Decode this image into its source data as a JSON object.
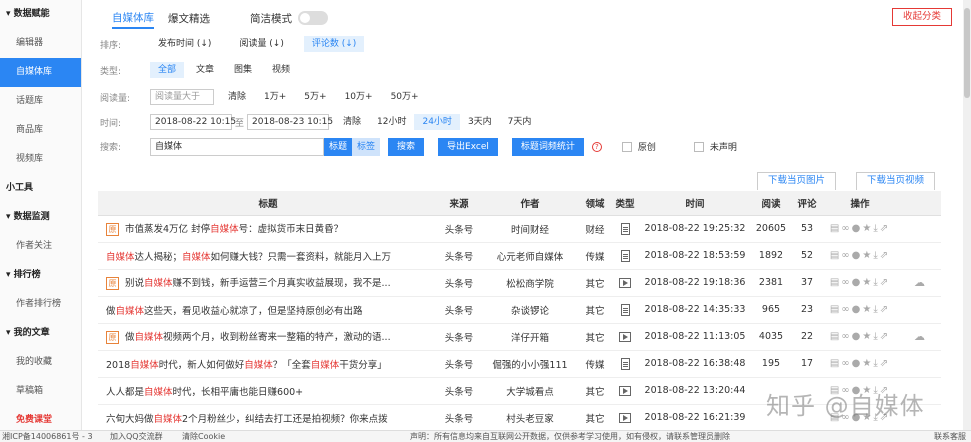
{
  "sidebar": {
    "items": [
      {
        "label": "▾ 数据赋能",
        "kind": "section"
      },
      {
        "label": "编辑器",
        "kind": "item"
      },
      {
        "label": "自媒体库",
        "kind": "active"
      },
      {
        "label": "话题库",
        "kind": "item"
      },
      {
        "label": "商品库",
        "kind": "item"
      },
      {
        "label": "视频库",
        "kind": "item"
      },
      {
        "label": "小工具",
        "kind": "section"
      },
      {
        "label": "▾ 数据监测",
        "kind": "section"
      },
      {
        "label": "作者关注",
        "kind": "item"
      },
      {
        "label": "▾ 排行榜",
        "kind": "section"
      },
      {
        "label": "作者排行榜",
        "kind": "item"
      },
      {
        "label": "▾ 我的文章",
        "kind": "section"
      },
      {
        "label": "我的收藏",
        "kind": "item"
      },
      {
        "label": "草稿箱",
        "kind": "item"
      },
      {
        "label": "免费课堂",
        "kind": "red"
      }
    ]
  },
  "tabs": {
    "tab1": "自媒体库",
    "tab2": "爆文精选",
    "simple_mode": "简洁模式"
  },
  "collapse_button": "收起分类",
  "filters": {
    "sort": {
      "label": "排序:",
      "options": [
        "发布时间 (↓)",
        "阅读量 (↓)",
        "评论数 (↓)"
      ],
      "selected": 2
    },
    "type": {
      "label": "类型:",
      "options": [
        "全部",
        "文章",
        "图集",
        "视频"
      ],
      "selected": 0
    },
    "reads": {
      "label": "阅读量:",
      "placeholder": "阅读量大于",
      "options": [
        "清除",
        "1万+",
        "5万+",
        "10万+",
        "50万+"
      ]
    },
    "time": {
      "label": "时间:",
      "start": "2018-08-22 10:15",
      "sep": "至",
      "end": "2018-08-23 10:15",
      "options": [
        "清除",
        "12小时",
        "24小时",
        "3天内",
        "7天内"
      ],
      "selected": 2
    },
    "search": {
      "label": "搜索:",
      "value": "自媒体",
      "mode1": "标题",
      "mode2": "标签",
      "btn_search": "搜索",
      "btn_export": "导出Excel",
      "btn_stats": "标题词频统计",
      "help": "?",
      "chk_original": "原创",
      "chk_undeclared": "未声明"
    }
  },
  "download": {
    "images": "下载当页图片",
    "videos": "下载当页视频"
  },
  "table": {
    "headers": [
      "标题",
      "来源",
      "作者",
      "领域",
      "类型",
      "时间",
      "阅读",
      "评论",
      "操作"
    ],
    "rows": [
      {
        "badge": "原",
        "p1": "市值蒸发4万亿 封停",
        "hl": "自媒体",
        "p2": "号：虚拟货币末日黄昏？",
        "source": "头条号",
        "author": "时间财经",
        "field": "财经",
        "type": "doc",
        "time": "2018-08-22 19:25:32",
        "reads": "20605",
        "comments": "53",
        "cloud": ""
      },
      {
        "badge": "",
        "p1": "",
        "hl": "自媒体",
        "p2": "达人揭秘；",
        "hl2": "自媒体",
        "p3": "如何赚大钱？只需一套资料，就能月入上万",
        "source": "头条号",
        "author": "心元老师自媒体",
        "field": "传媒",
        "type": "doc",
        "time": "2018-08-22 18:53:59",
        "reads": "1892",
        "comments": "52",
        "cloud": ""
      },
      {
        "badge": "原",
        "p1": "别说",
        "hl": "自媒体",
        "p2": "赚不到钱，新手运营三个月真实收益展现，我不是...",
        "source": "头条号",
        "author": "松松商学院",
        "field": "其它",
        "type": "vid",
        "time": "2018-08-22 19:18:36",
        "reads": "2381",
        "comments": "37",
        "cloud": "☁"
      },
      {
        "badge": "",
        "p1": "做",
        "hl": "自媒体",
        "p2": "这些天，看见收益心就凉了，但是坚持原创必有出路",
        "source": "头条号",
        "author": "杂谈锣论",
        "field": "其它",
        "type": "doc",
        "time": "2018-08-22 14:35:33",
        "reads": "965",
        "comments": "23",
        "cloud": ""
      },
      {
        "badge": "原",
        "p1": "做",
        "hl": "自媒体",
        "p2": "视频两个月，收到粉丝寄来一整箱的特产，激动的语...",
        "source": "头条号",
        "author": "洋仔开箱",
        "field": "其它",
        "type": "vid",
        "time": "2018-08-22 11:13:05",
        "reads": "4035",
        "comments": "22",
        "cloud": "☁"
      },
      {
        "badge": "",
        "p1": "2018",
        "hl": "自媒体",
        "p2": "时代，新人如何做好",
        "hl2": "自媒体",
        "p3": "？「全套",
        "hl3": "自媒体",
        "p4": "干货分享」",
        "source": "头条号",
        "author": "倔强的小小强111",
        "field": "传媒",
        "type": "doc",
        "time": "2018-08-22 16:38:48",
        "reads": "195",
        "comments": "17",
        "cloud": ""
      },
      {
        "badge": "",
        "p1": "人人都是",
        "hl": "自媒体",
        "p2": "时代，长相平庸也能日赚600+",
        "source": "头条号",
        "author": "大学城看点",
        "field": "其它",
        "type": "vid",
        "time": "2018-08-22 13:20:44",
        "reads": "",
        "comments": "",
        "cloud": ""
      },
      {
        "badge": "",
        "p1": "六旬大妈做",
        "hl": "自媒体",
        "p2": "2个月粉丝少，纠结去打工还是拍视频？你来点拨",
        "source": "头条号",
        "author": "村头老豆家",
        "field": "其它",
        "type": "vid",
        "time": "2018-08-22 16:21:39",
        "reads": "",
        "comments": "",
        "cloud": ""
      }
    ]
  },
  "footer": {
    "icp": "湘ICP备14006861号 - 3",
    "qq": "加入QQ交流群",
    "clear": "清除Cookie",
    "notice": "声明：所有信息均来自互联网公开数据，仅供参考学习使用，如有侵权，请联系管理员删除",
    "contact": "联系客服"
  },
  "watermark": "知乎 @自媒体",
  "colors": {
    "accent": "#2b86f3",
    "highlight": "#e53935",
    "badge": "#e8833a"
  }
}
